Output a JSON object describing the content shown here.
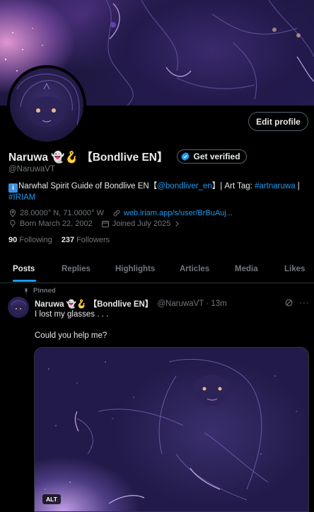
{
  "profile": {
    "display_name": "Naruwa 👻🪝 【Bondlive EN】",
    "handle": "@NaruwaVT",
    "edit_label": "Edit profile",
    "verify_label": "Get verified",
    "bio": {
      "info_glyph": "i",
      "text_1": "Narwhal Spirit Guide of Bondlive EN【",
      "mention": "@bondliver_en",
      "text_2": "】| Art Tag: ",
      "hashtag_1": "#artnaruwa",
      "text_3": " | ",
      "hashtag_2": "#IRIAM"
    },
    "location": "28.0000° N, 71.0000° W",
    "website": "web.iriam.app/s/user/BrBuAuj...",
    "born": "Born March 22, 2002",
    "joined": "Joined July 2025",
    "following_count": "90",
    "following_label": "Following",
    "followers_count": "237",
    "followers_label": "Followers"
  },
  "tabs": [
    {
      "label": "Posts"
    },
    {
      "label": "Replies"
    },
    {
      "label": "Highlights"
    },
    {
      "label": "Articles"
    },
    {
      "label": "Media"
    },
    {
      "label": "Likes"
    }
  ],
  "post": {
    "pinned_label": "Pinned",
    "author": "Naruwa 👻🪝 【Bondlive EN】",
    "handle_time": "@NaruwaVT · 13m",
    "line_1": "I lost my glasses . . .",
    "line_2": "Could you help me?",
    "alt_label": "ALT",
    "more": "···"
  },
  "colors": {
    "accent": "#1d9bf0",
    "muted": "#71767b",
    "text": "#e7e9ea",
    "border": "#2f3336"
  },
  "icons": [
    "location-icon",
    "link-icon",
    "balloon-icon",
    "calendar-icon",
    "pin-icon",
    "grok-icon",
    "more-icon",
    "verified-badge-icon"
  ]
}
